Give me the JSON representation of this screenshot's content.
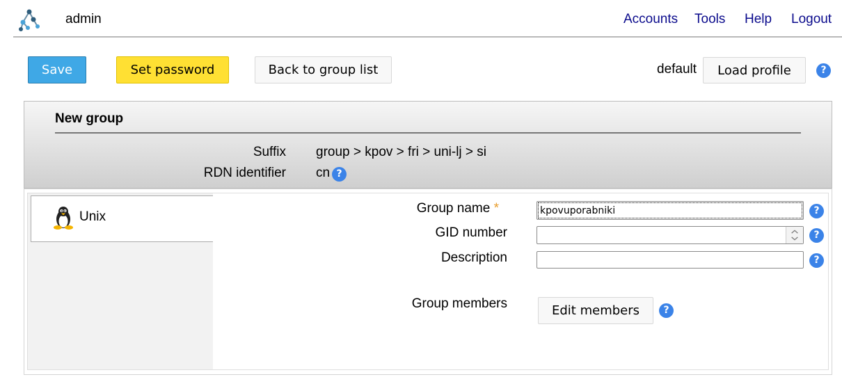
{
  "header": {
    "user": "admin",
    "nav": [
      "Accounts",
      "Tools",
      "Help",
      "Logout"
    ]
  },
  "toolbar": {
    "save_label": "Save",
    "set_password_label": "Set password",
    "back_label": "Back to group list",
    "profile_name": "default",
    "load_profile_label": "Load profile",
    "help_glyph": "?"
  },
  "panel": {
    "title": "New group",
    "suffix_label": "Suffix",
    "suffix_value": "group > kpov > fri > uni-lj > si",
    "rdn_label": "RDN identifier",
    "rdn_value": "cn"
  },
  "tabs": [
    {
      "label": "Unix",
      "icon": "tux-icon"
    }
  ],
  "form": {
    "group_name_label": "Group name",
    "required_mark": "*",
    "group_name_value": "kpovuporabniki",
    "gid_label": "GID number",
    "gid_value": "",
    "description_label": "Description",
    "description_value": "",
    "members_label": "Group members",
    "edit_members_label": "Edit members"
  },
  "colors": {
    "save_button": "#3fa8e6",
    "set_password_button": "#ffe033",
    "nav_link": "#0a0a8c",
    "help_icon": "#3b83e8",
    "required_star": "#e79c2a"
  }
}
